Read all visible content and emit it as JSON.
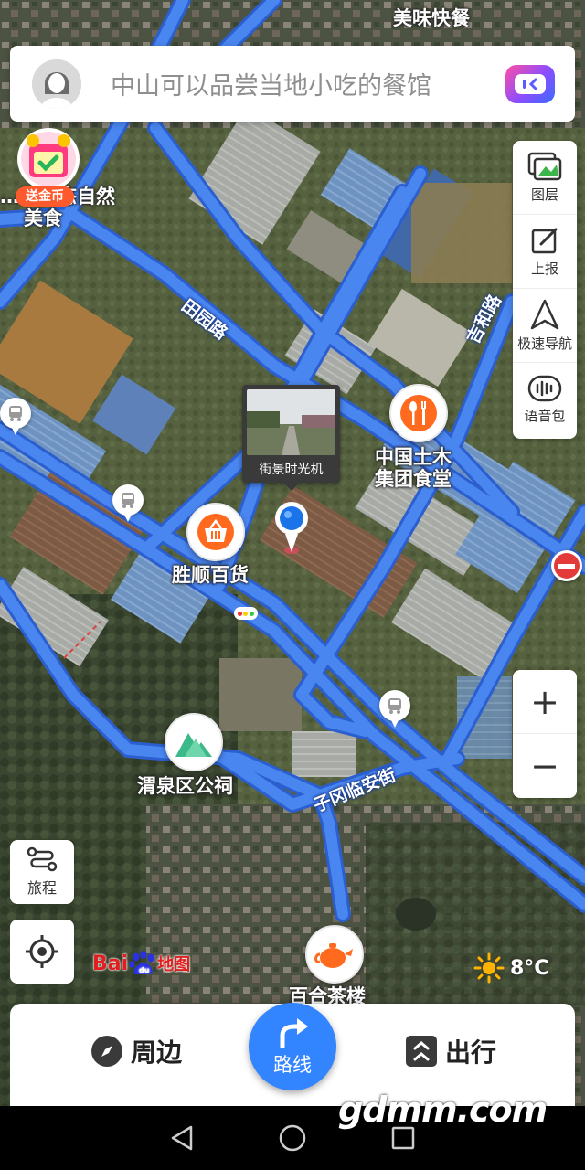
{
  "search": {
    "placeholder": "中山可以品尝当地小吃的餐馆"
  },
  "toolbar": {
    "items": [
      {
        "label": "图层",
        "icon": "layers-icon"
      },
      {
        "label": "上报",
        "icon": "report-icon"
      },
      {
        "label": "极速导航",
        "icon": "navigation-icon"
      },
      {
        "label": "语音包",
        "icon": "voice-pack-icon"
      }
    ]
  },
  "zoom": {
    "in": "+",
    "out": "−"
  },
  "trip": {
    "label": "旅程"
  },
  "gold_coin": {
    "label": "送金币"
  },
  "map": {
    "road_labels": {
      "tianyuan": "田园路",
      "road_ne": "吉和路",
      "ziwang": "子冈临安街"
    },
    "pois": {
      "top_right": "美味快餐",
      "top_left_line1": "…原生态自然",
      "top_left_line2": "美食",
      "canteen_line1": "中国土木",
      "canteen_line2": "集团食堂",
      "shengshun": "胜顺百货",
      "ancestral_hall": "渭泉区公祠",
      "teahouse": "百合茶楼"
    },
    "streetview_label": "街景时光机",
    "logo": {
      "bai": "Bai",
      "map": "地图"
    },
    "weather": {
      "temp": "8°C",
      "icon": "sun-icon"
    }
  },
  "bottom": {
    "nearby": "周边",
    "route": "路线",
    "travel": "出行"
  },
  "watermark": "gdmm.com",
  "colors": {
    "road": "#4a86f0",
    "road_edge": "#2b5fcf",
    "accent": "#3385ff",
    "poi_orange": "#ff6a1f",
    "poi_green": "#3cb98a"
  }
}
